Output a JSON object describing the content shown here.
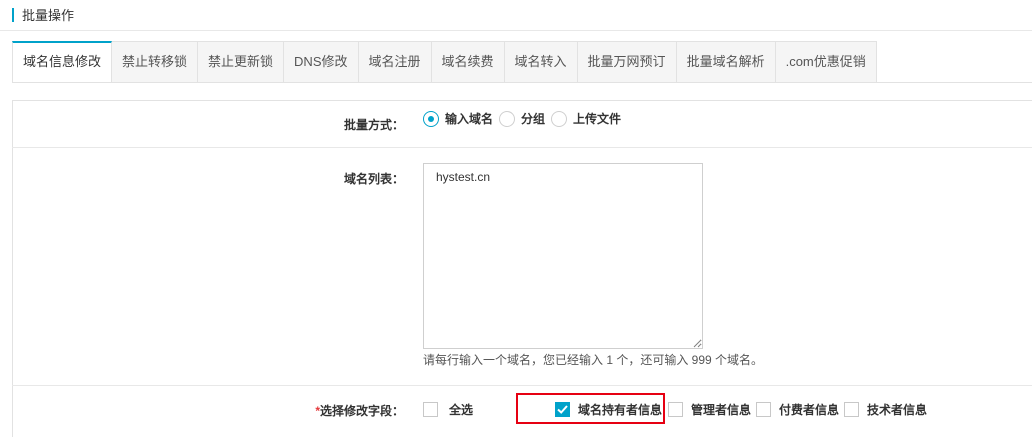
{
  "header": {
    "title": "批量操作"
  },
  "tabs": [
    {
      "label": "域名信息修改",
      "active": true
    },
    {
      "label": "禁止转移锁"
    },
    {
      "label": "禁止更新锁"
    },
    {
      "label": "DNS修改"
    },
    {
      "label": "域名注册"
    },
    {
      "label": "域名续费"
    },
    {
      "label": "域名转入"
    },
    {
      "label": "批量万网预订"
    },
    {
      "label": "批量域名解析"
    },
    {
      "label": ".com优惠促销"
    }
  ],
  "form": {
    "method": {
      "label": "批量方式：",
      "options": [
        {
          "label": "输入域名",
          "checked": true
        },
        {
          "label": "分组",
          "checked": false
        },
        {
          "label": "上传文件",
          "checked": false
        }
      ]
    },
    "domain_list": {
      "label": "域名列表：",
      "value": "hystest.cn",
      "hint": "请每行输入一个域名，您已经输入 1 个，还可输入 999 个域名。"
    },
    "fields": {
      "required_mark": "*",
      "label": "选择修改字段：",
      "select_all": {
        "label": "全选",
        "checked": false
      },
      "options": [
        {
          "label": "域名持有者信息",
          "checked": true
        },
        {
          "label": "管理者信息",
          "checked": false
        },
        {
          "label": "付费者信息",
          "checked": false
        },
        {
          "label": "技术者信息",
          "checked": false
        }
      ]
    }
  },
  "colors": {
    "accent": "#00a2ca",
    "highlight": "#e60012",
    "required": "#e4393c"
  },
  "icons": [
    "check-icon",
    "resize-handle-icon"
  ]
}
